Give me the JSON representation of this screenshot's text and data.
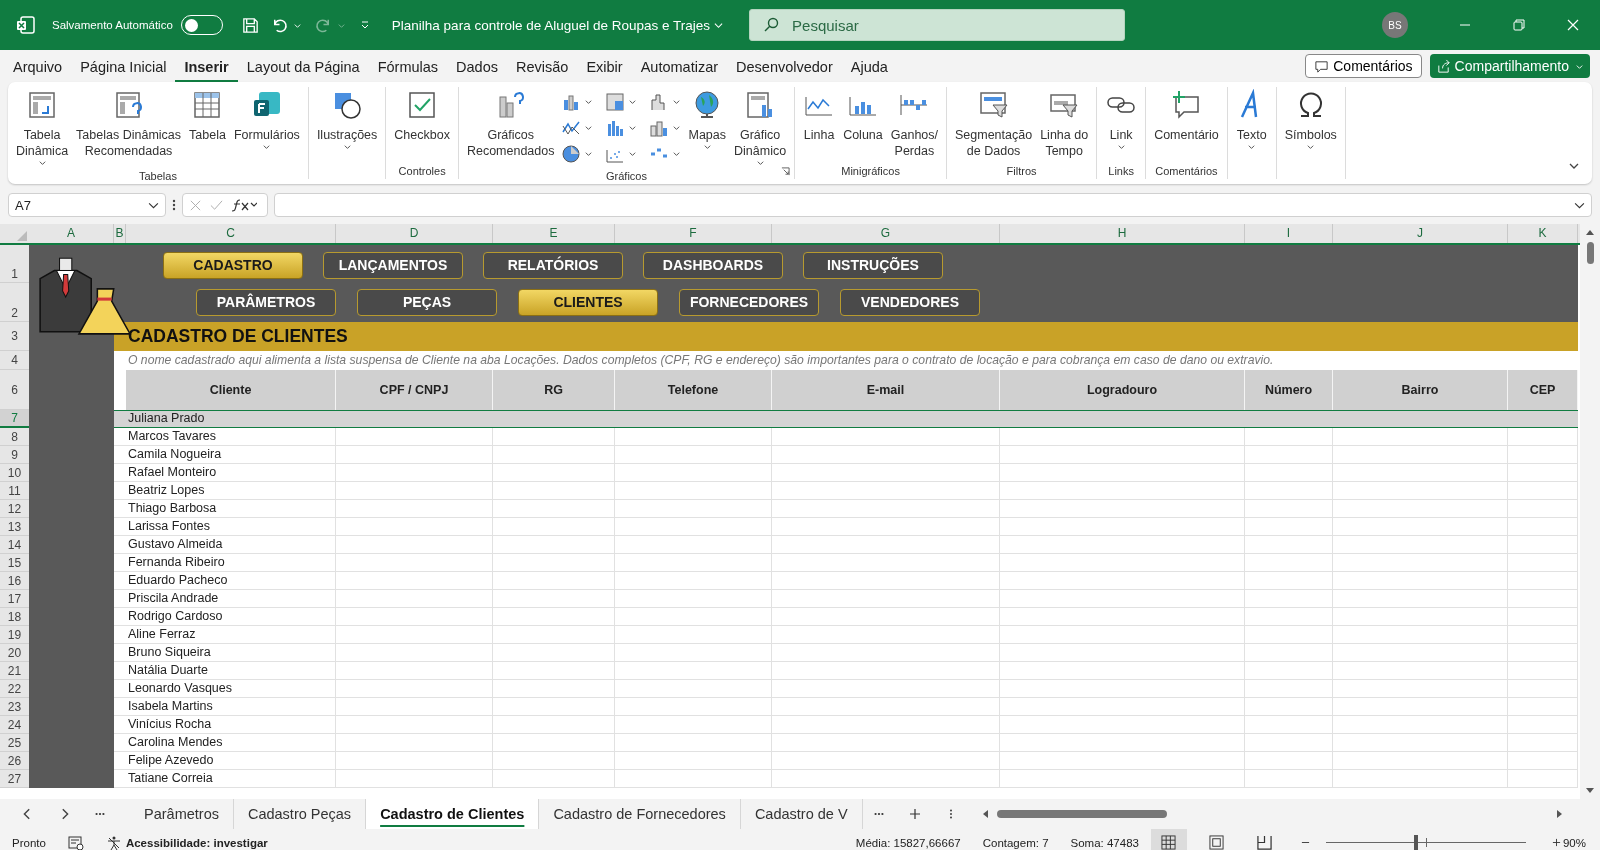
{
  "title_bar": {
    "autosave": {
      "label": "Salvamento Automático",
      "on": false
    },
    "document_title": "Planilha para controle de Aluguel de Roupas e Trajes",
    "search": {
      "placeholder": "Pesquisar"
    },
    "avatar": "BS"
  },
  "menu_tabs": [
    {
      "label": "Arquivo",
      "selected": false
    },
    {
      "label": "Página Inicial",
      "selected": false
    },
    {
      "label": "Inserir",
      "selected": true
    },
    {
      "label": "Layout da Página",
      "selected": false
    },
    {
      "label": "Fórmulas",
      "selected": false
    },
    {
      "label": "Dados",
      "selected": false
    },
    {
      "label": "Revisão",
      "selected": false
    },
    {
      "label": "Exibir",
      "selected": false
    },
    {
      "label": "Automatizar",
      "selected": false
    },
    {
      "label": "Desenvolvedor",
      "selected": false
    },
    {
      "label": "Ajuda",
      "selected": false
    }
  ],
  "comments_button": "Comentários",
  "share_button": "Compartilhamento",
  "ribbon": [
    {
      "label": "Tabelas",
      "items": [
        {
          "kind": "large",
          "label": "Tabela\nDinâmica",
          "dropdown": true
        },
        {
          "kind": "large",
          "label": "Tabelas Dinâmicas\nRecomendadas",
          "dropdown": false
        },
        {
          "kind": "large",
          "label": "Tabela",
          "dropdown": false
        },
        {
          "kind": "large",
          "label": "Formulários",
          "dropdown": true
        }
      ]
    },
    {
      "items": [
        {
          "kind": "large",
          "label": "Ilustrações",
          "dropdown": true
        }
      ]
    },
    {
      "label": "Controles",
      "items": [
        {
          "kind": "large",
          "label": "Checkbox",
          "dropdown": false
        }
      ]
    },
    {
      "label": "Gráficos",
      "launcher": true,
      "items": [
        {
          "kind": "large",
          "label": "Gráficos\nRecomendados",
          "dropdown": false
        },
        {
          "kind": "small-grid",
          "buttons": [
            {
              "dropdown": true
            },
            {
              "dropdown": true
            },
            {
              "dropdown": true
            },
            {
              "dropdown": true
            },
            {
              "dropdown": true
            },
            {
              "dropdown": true
            },
            {
              "dropdown": true
            },
            {
              "dropdown": true
            },
            {
              "dropdown": true
            }
          ]
        },
        {
          "kind": "large",
          "label": "Mapas",
          "dropdown": true
        },
        {
          "kind": "large",
          "label": "Gráfico\nDinâmico",
          "dropdown": true
        }
      ]
    },
    {
      "label": "Minigráficos",
      "items": [
        {
          "kind": "large",
          "label": "Linha",
          "dropdown": false
        },
        {
          "kind": "large",
          "label": "Coluna",
          "dropdown": false
        },
        {
          "kind": "large",
          "label": "Ganhos/\nPerdas",
          "dropdown": false
        }
      ]
    },
    {
      "label": "Filtros",
      "items": [
        {
          "kind": "large",
          "label": "Segmentação\nde Dados",
          "dropdown": false
        },
        {
          "kind": "large",
          "label": "Linha do\nTempo",
          "dropdown": false
        }
      ]
    },
    {
      "label": "Links",
      "items": [
        {
          "kind": "large",
          "label": "Link",
          "dropdown": true
        }
      ]
    },
    {
      "label": "Comentários",
      "items": [
        {
          "kind": "large",
          "label": "Comentário",
          "dropdown": false
        }
      ]
    },
    {
      "items": [
        {
          "kind": "large",
          "label": "Texto",
          "dropdown": true
        }
      ]
    },
    {
      "items": [
        {
          "kind": "large",
          "label": "Símbolos",
          "dropdown": true
        }
      ]
    }
  ],
  "formula_bar": {
    "name_box": "A7"
  },
  "column_letters": [
    "A",
    "B",
    "C",
    "D",
    "E",
    "F",
    "G",
    "H",
    "I",
    "J",
    "K"
  ],
  "sheet": {
    "top_row_numbers": [
      "1",
      "2",
      "3",
      "4",
      "6"
    ],
    "nav_row_1": [
      {
        "label": "CADASTRO",
        "selected": true
      },
      {
        "label": "LANÇAMENTOS",
        "selected": false
      },
      {
        "label": "RELATÓRIOS",
        "selected": false
      },
      {
        "label": "DASHBOARDS",
        "selected": false
      },
      {
        "label": "INSTRUÇÕES",
        "selected": false
      }
    ],
    "nav_row_2": [
      {
        "label": "PARÂMETROS",
        "selected": false
      },
      {
        "label": "PEÇAS",
        "selected": false
      },
      {
        "label": "CLIENTES",
        "selected": true
      },
      {
        "label": "FORNECEDORES",
        "selected": false
      },
      {
        "label": "VENDEDORES",
        "selected": false
      }
    ],
    "banner": "CADASTRO DE CLIENTES",
    "note": "O nome cadastrado aqui alimenta a lista suspensa de Cliente na aba Locações. Dados completos (CPF, RG e endereço) são importantes para o contrato de locação e para cobrança em caso de dano ou extravio.",
    "columns": [
      "Cliente",
      "CPF / CNPJ",
      "RG",
      "Telefone",
      "E-mail",
      "Logradouro",
      "Número",
      "Bairro",
      "CEP"
    ],
    "rows": [
      {
        "number": "7",
        "client": "Juliana Prado",
        "selected": true
      },
      {
        "number": "8",
        "client": "Marcos Tavares",
        "selected": false
      },
      {
        "number": "9",
        "client": "Camila Nogueira",
        "selected": false
      },
      {
        "number": "10",
        "client": "Rafael Monteiro",
        "selected": false
      },
      {
        "number": "11",
        "client": "Beatriz Lopes",
        "selected": false
      },
      {
        "number": "12",
        "client": "Thiago Barbosa",
        "selected": false
      },
      {
        "number": "13",
        "client": "Larissa Fontes",
        "selected": false
      },
      {
        "number": "14",
        "client": "Gustavo Almeida",
        "selected": false
      },
      {
        "number": "15",
        "client": "Fernanda Ribeiro",
        "selected": false
      },
      {
        "number": "16",
        "client": "Eduardo Pacheco",
        "selected": false
      },
      {
        "number": "17",
        "client": "Priscila Andrade",
        "selected": false
      },
      {
        "number": "18",
        "client": "Rodrigo Cardoso",
        "selected": false
      },
      {
        "number": "19",
        "client": "Aline Ferraz",
        "selected": false
      },
      {
        "number": "20",
        "client": "Bruno Siqueira",
        "selected": false
      },
      {
        "number": "21",
        "client": "Natália Duarte",
        "selected": false
      },
      {
        "number": "22",
        "client": "Leonardo Vasques",
        "selected": false
      },
      {
        "number": "23",
        "client": "Isabela Martins",
        "selected": false
      },
      {
        "number": "24",
        "client": "Vinícius Rocha",
        "selected": false
      },
      {
        "number": "25",
        "client": "Carolina Mendes",
        "selected": false
      },
      {
        "number": "26",
        "client": "Felipe Azevedo",
        "selected": false
      },
      {
        "number": "27",
        "client": "Tatiane Correia",
        "selected": false
      }
    ]
  },
  "sheet_tabs": [
    {
      "label": "Parâmetros",
      "selected": false
    },
    {
      "label": "Cadastro Peças",
      "selected": false
    },
    {
      "label": "Cadastro de Clientes",
      "selected": true
    },
    {
      "label": "Cadastro de Fornecedores",
      "selected": false
    },
    {
      "label": "Cadastro de V",
      "selected": false
    }
  ],
  "status_bar": {
    "ready": "Pronto",
    "accessibility": "Acessibilidade: investigar",
    "stats": [
      "Média: 15827,66667",
      "Contagem: 7",
      "Soma: 47483"
    ],
    "views": [
      {
        "selected": true
      },
      {
        "selected": false
      },
      {
        "selected": false
      }
    ],
    "zoom": {
      "level": 0.45,
      "label": "90%"
    }
  }
}
